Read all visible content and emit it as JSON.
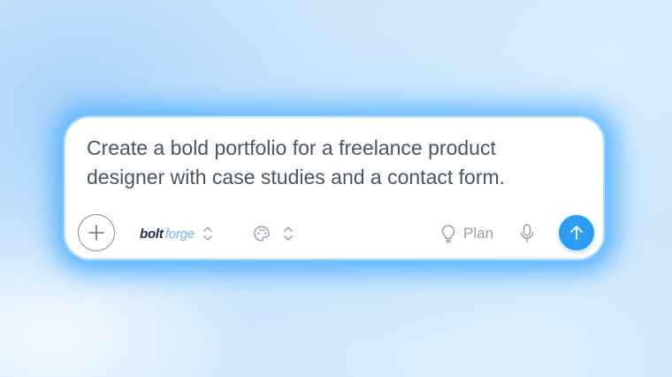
{
  "prompt": {
    "text": "Create a bold portfolio for a freelance product\ndesigner with case studies and a contact form."
  },
  "toolbar": {
    "attach_icon": "plus-icon",
    "model": {
      "brand_bold": "bolt",
      "brand_light": "forge",
      "icon": "chevron-up-down-icon"
    },
    "theme": {
      "icon": "palette-icon",
      "chevron_icon": "chevron-up-down-icon"
    },
    "plan": {
      "label": "Plan",
      "icon": "lightbulb-icon"
    },
    "mic_icon": "microphone-icon",
    "send_icon": "arrow-up-icon"
  },
  "colors": {
    "accent": "#2f9cf3",
    "brand_dark": "#1f2a44",
    "brand_light": "#6fb7ef",
    "text": "#4b5563",
    "muted": "#9aa0a8",
    "glow": "#28a0ff"
  }
}
